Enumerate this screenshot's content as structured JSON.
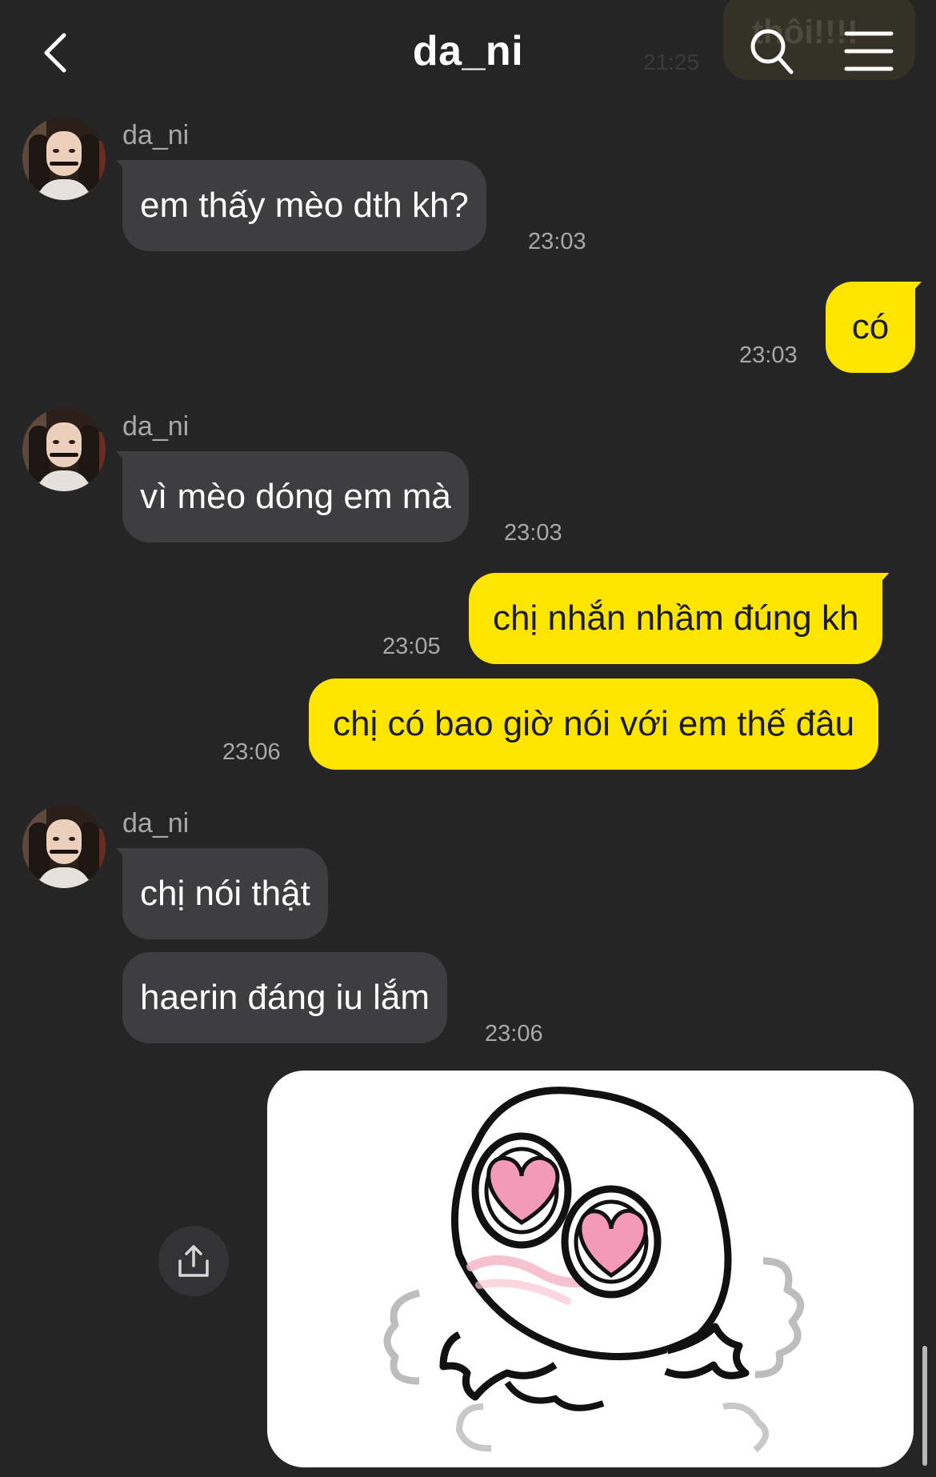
{
  "header": {
    "title": "da_ni",
    "ghost_message_text": "thôi!!!!",
    "ghost_message_time": "21:25"
  },
  "icons": {
    "back": "chevron-left-icon",
    "search": "search-icon",
    "menu": "hamburger-menu-icon",
    "share": "share-upload-icon"
  },
  "colors": {
    "background": "#252526",
    "incoming_bubble": "#3e3e40",
    "outgoing_bubble": "#fde500"
  },
  "messages": [
    {
      "direction": "in",
      "sender": "da_ni",
      "text": "em thấy mèo dth kh?",
      "time": "23:03"
    },
    {
      "direction": "out",
      "text": "có",
      "time": "23:03"
    },
    {
      "direction": "in",
      "sender": "da_ni",
      "text": "vì mèo dóng em mà",
      "time": "23:03"
    },
    {
      "direction": "out",
      "text": "chị nhắn nhầm đúng kh",
      "time": "23:05"
    },
    {
      "direction": "out",
      "text": "chị có bao giờ nói với em thế đâu",
      "time": "23:06"
    },
    {
      "direction": "in",
      "sender": "da_ni",
      "text": "chị nói thật",
      "time": ""
    },
    {
      "direction": "in",
      "text": "haerin đáng iu lắm",
      "time": "23:06"
    },
    {
      "direction": "out",
      "type": "sticker",
      "sticker": "heart-eyes-blob-sticker"
    }
  ]
}
